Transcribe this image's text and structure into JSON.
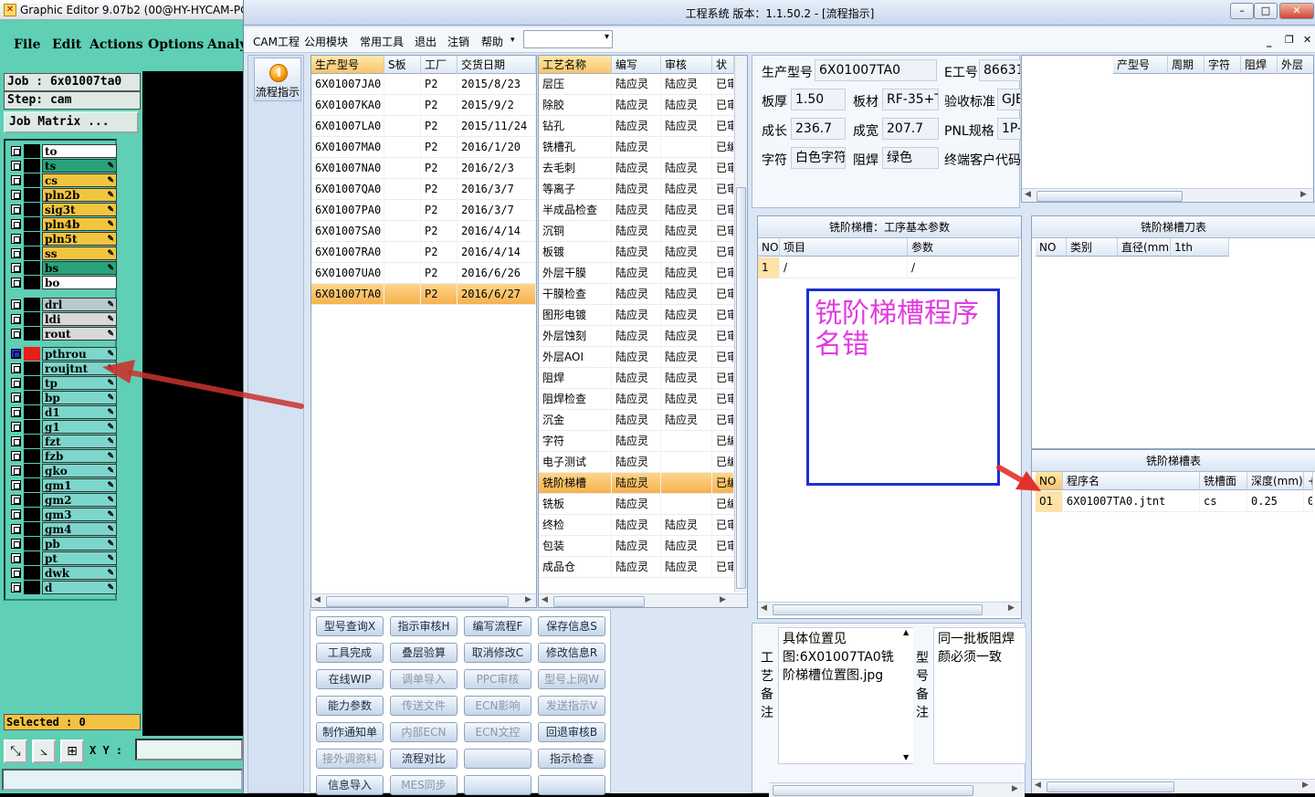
{
  "ge": {
    "title": "Graphic Editor 9.07b2 (00@HY-HYCAM-PC",
    "menu": [
      "File",
      "Edit",
      "Actions",
      "Options",
      "Analy"
    ],
    "job": "Job  : 6x01007ta0",
    "step": "Step: cam",
    "matrix": "Job Matrix ...",
    "layers": [
      {
        "name": "to",
        "color": "#ffffff"
      },
      {
        "name": "ts",
        "color": "#2aa37a"
      },
      {
        "name": "cs",
        "color": "#f2c540"
      },
      {
        "name": "pln2b",
        "color": "#f2c540"
      },
      {
        "name": "sig3t",
        "color": "#f2c540"
      },
      {
        "name": "pln4b",
        "color": "#f2c540"
      },
      {
        "name": "pln5t",
        "color": "#f2c540"
      },
      {
        "name": "ss",
        "color": "#f2c540"
      },
      {
        "name": "bs",
        "color": "#2aa37a"
      },
      {
        "name": "bo",
        "color": "#ffffff"
      },
      {
        "name": "drl",
        "color": "#b9c9cc"
      },
      {
        "name": "ldi",
        "color": "#d9d9d9"
      },
      {
        "name": "rout",
        "color": "#d9d9d9"
      },
      {
        "name": "pthrou",
        "color": "#7dd6cb"
      },
      {
        "name": "roujtnt",
        "color": "#7dd6cb"
      },
      {
        "name": "tp",
        "color": "#7dd6cb"
      },
      {
        "name": "bp",
        "color": "#7dd6cb"
      },
      {
        "name": "d1",
        "color": "#7dd6cb"
      },
      {
        "name": "g1",
        "color": "#7dd6cb"
      },
      {
        "name": "fzt",
        "color": "#7dd6cb"
      },
      {
        "name": "fzb",
        "color": "#7dd6cb"
      },
      {
        "name": "gko",
        "color": "#7dd6cb"
      },
      {
        "name": "gm1",
        "color": "#7dd6cb"
      },
      {
        "name": "gm2",
        "color": "#7dd6cb"
      },
      {
        "name": "gm3",
        "color": "#7dd6cb"
      },
      {
        "name": "gm4",
        "color": "#7dd6cb"
      },
      {
        "name": "pb",
        "color": "#7dd6cb"
      },
      {
        "name": "pt",
        "color": "#7dd6cb"
      },
      {
        "name": "dwk",
        "color": "#7dd6cb"
      },
      {
        "name": "d",
        "color": "#7dd6cb"
      }
    ],
    "selected": "Selected : 0",
    "xy_label": "X Y :"
  },
  "main": {
    "title": "工程系统    版本：1.1.50.2 - [流程指示]",
    "menu": [
      "CAM工程",
      "公用模块",
      "常用工具",
      "退出",
      "注销",
      "帮助"
    ],
    "nav_button": "流程指示",
    "models_grid": {
      "headers": [
        "生产型号",
        "S板",
        "工厂",
        "交货日期"
      ],
      "rows": [
        [
          "6X01007JA0",
          "",
          "P2",
          "2015/8/23"
        ],
        [
          "6X01007KA0",
          "",
          "P2",
          "2015/9/2"
        ],
        [
          "6X01007LA0",
          "",
          "P2",
          "2015/11/24"
        ],
        [
          "6X01007MA0",
          "",
          "P2",
          "2016/1/20"
        ],
        [
          "6X01007NA0",
          "",
          "P2",
          "2016/2/3"
        ],
        [
          "6X01007QA0",
          "",
          "P2",
          "2016/3/7"
        ],
        [
          "6X01007PA0",
          "",
          "P2",
          "2016/3/7"
        ],
        [
          "6X01007SA0",
          "",
          "P2",
          "2016/4/14"
        ],
        [
          "6X01007RA0",
          "",
          "P2",
          "2016/4/14"
        ],
        [
          "6X01007UA0",
          "",
          "P2",
          "2016/6/26"
        ],
        [
          "6X01007TA0",
          "",
          "P2",
          "2016/6/27"
        ]
      ],
      "selected_row": 10
    },
    "process_grid": {
      "headers": [
        "工艺名称",
        "编写",
        "审核",
        "状"
      ],
      "rows": [
        [
          "层压",
          "陆应灵",
          "陆应灵",
          "已审"
        ],
        [
          "除胶",
          "陆应灵",
          "陆应灵",
          "已审"
        ],
        [
          "钻孔",
          "陆应灵",
          "陆应灵",
          "已审"
        ],
        [
          "铣槽孔",
          "陆应灵",
          "",
          "已编"
        ],
        [
          "去毛刺",
          "陆应灵",
          "陆应灵",
          "已审"
        ],
        [
          "等离子",
          "陆应灵",
          "陆应灵",
          "已审"
        ],
        [
          "半成品检查",
          "陆应灵",
          "陆应灵",
          "已审"
        ],
        [
          "沉铜",
          "陆应灵",
          "陆应灵",
          "已审"
        ],
        [
          "板镀",
          "陆应灵",
          "陆应灵",
          "已审"
        ],
        [
          "外层干膜",
          "陆应灵",
          "陆应灵",
          "已审"
        ],
        [
          "干膜检查",
          "陆应灵",
          "陆应灵",
          "已审"
        ],
        [
          "图形电镀",
          "陆应灵",
          "陆应灵",
          "已审"
        ],
        [
          "外层蚀刻",
          "陆应灵",
          "陆应灵",
          "已审"
        ],
        [
          "外层AOI",
          "陆应灵",
          "陆应灵",
          "已审"
        ],
        [
          "阻焊",
          "陆应灵",
          "陆应灵",
          "已审"
        ],
        [
          "阻焊检查",
          "陆应灵",
          "陆应灵",
          "已审"
        ],
        [
          "沉金",
          "陆应灵",
          "陆应灵",
          "已审"
        ],
        [
          "字符",
          "陆应灵",
          "",
          "已编"
        ],
        [
          "电子测试",
          "陆应灵",
          "",
          "已编"
        ],
        [
          "铣阶梯槽",
          "陆应灵",
          "",
          "已编"
        ],
        [
          "铣板",
          "陆应灵",
          "",
          "已编"
        ],
        [
          "终检",
          "陆应灵",
          "陆应灵",
          "已审"
        ],
        [
          "包装",
          "陆应灵",
          "陆应灵",
          "已审"
        ],
        [
          "成品仓",
          "陆应灵",
          "陆应灵",
          "已审"
        ]
      ],
      "selected_row": 19
    },
    "buttons": [
      {
        "label": "型号查询X",
        "enabled": true
      },
      {
        "label": "指示审核H",
        "enabled": true
      },
      {
        "label": "编写流程F",
        "enabled": true
      },
      {
        "label": "保存信息S",
        "enabled": true
      },
      {
        "label": "工具完成",
        "enabled": true
      },
      {
        "label": "叠层验算",
        "enabled": true
      },
      {
        "label": "取消修改C",
        "enabled": true
      },
      {
        "label": "修改信息R",
        "enabled": true
      },
      {
        "label": "在线WIP",
        "enabled": true
      },
      {
        "label": "调单导入",
        "enabled": false
      },
      {
        "label": "PPC审核",
        "enabled": false
      },
      {
        "label": "型号上网W",
        "enabled": false
      },
      {
        "label": "能力参数",
        "enabled": true
      },
      {
        "label": "传送文件",
        "enabled": false
      },
      {
        "label": "ECN影响",
        "enabled": false
      },
      {
        "label": "发送指示V",
        "enabled": false
      },
      {
        "label": "制作通知单",
        "enabled": true
      },
      {
        "label": "内部ECN",
        "enabled": false
      },
      {
        "label": "ECN文控",
        "enabled": false
      },
      {
        "label": "回退审核B",
        "enabled": true
      },
      {
        "label": "接外调资料",
        "enabled": false
      },
      {
        "label": "流程对比",
        "enabled": true
      },
      {
        "label": "",
        "enabled": true
      },
      {
        "label": "指示检查",
        "enabled": true
      },
      {
        "label": "信息导入",
        "enabled": true
      },
      {
        "label": "MES同步",
        "enabled": false
      },
      {
        "label": "",
        "enabled": true
      },
      {
        "label": "",
        "enabled": true
      }
    ],
    "info": {
      "model_label": "生产型号",
      "model_value": "6X01007TA0",
      "eno_label": "E工号",
      "eno_value": "86631",
      "thick_label": "板厚",
      "thick_value": "1.50",
      "mat_label": "板材",
      "mat_value": "RF-35+T",
      "std_label": "验收标准",
      "std_value": "GJE",
      "len_label": "成长",
      "len_value": "236.7",
      "wid_label": "成宽",
      "wid_value": "207.7",
      "pnl_label": "PNL规格",
      "pnl_value": "1P-",
      "char_label": "字符",
      "char_value": "白色字符",
      "mask_label": "阻焊",
      "mask_value": "绿色",
      "cust_label": "终端客户代码"
    },
    "info_grid_headers": [
      "产型号",
      "周期",
      "字符",
      "阻焊",
      "外层"
    ],
    "param_panel": {
      "title": "铣阶梯槽：工序基本参数",
      "headers": [
        "NO",
        "项目",
        "参数"
      ],
      "row": [
        "1",
        "/",
        "/"
      ]
    },
    "error_text": "铣阶梯槽程序名错",
    "tool_panel": {
      "title": "铣阶梯槽刀表",
      "headers": [
        "NO",
        "类别",
        "直径(mm)",
        "1th"
      ]
    },
    "slot_panel": {
      "title": "铣阶梯槽表",
      "headers": [
        "NO",
        "程序名",
        "铣槽面",
        "深度(mm)",
        "+"
      ],
      "row": [
        "01",
        "6X01007TA0.jtnt",
        "cs",
        "0.25",
        "0"
      ]
    },
    "process_note_label": "工艺备注",
    "process_note": "具体位置见图:6X01007TA0铣阶梯槽位置图.jpg",
    "model_note_label": "型号备注",
    "model_note": "同一批板阻焊颜必须一致"
  }
}
